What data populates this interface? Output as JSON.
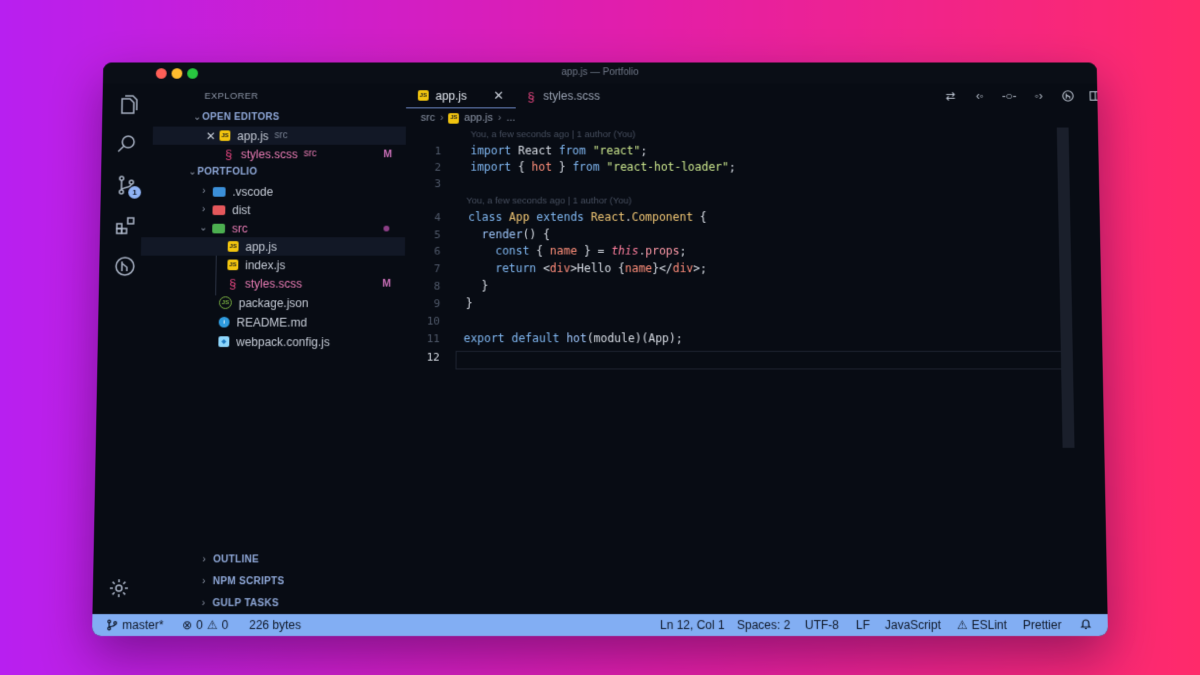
{
  "window": {
    "title": "app.js — Portfolio"
  },
  "sidebar": {
    "title": "EXPLORER",
    "open_editors": {
      "label": "OPEN EDITORS",
      "items": [
        {
          "name": "app.js",
          "hint": "src"
        },
        {
          "name": "styles.scss",
          "hint": "src",
          "status": "M"
        }
      ]
    },
    "project": {
      "label": "PORTFOLIO",
      "items": [
        {
          "name": ".vscode"
        },
        {
          "name": "dist"
        },
        {
          "name": "src"
        },
        {
          "name": "app.js"
        },
        {
          "name": "index.js"
        },
        {
          "name": "styles.scss",
          "status": "M"
        },
        {
          "name": "package.json"
        },
        {
          "name": "README.md"
        },
        {
          "name": "webpack.config.js"
        }
      ]
    },
    "bottom_sections": [
      "OUTLINE",
      "NPM SCRIPTS",
      "GULP TASKS"
    ],
    "scm_badge": "1"
  },
  "tabs": [
    {
      "label": "app.js",
      "active": true
    },
    {
      "label": "styles.scss",
      "active": false
    }
  ],
  "breadcrumb": [
    "src",
    "app.js",
    "..."
  ],
  "editor": {
    "blame_line": "You, a few seconds ago | 1 author (You)",
    "line_numbers": [
      "1",
      "2",
      "3",
      "4",
      "5",
      "6",
      "7",
      "8",
      "9",
      "10",
      "11",
      "12"
    ],
    "current_line": 12
  },
  "statusbar": {
    "branch": "master*",
    "errors": "0",
    "warnings": "0",
    "file_size": "226 bytes",
    "position": "Ln 12, Col 1",
    "spaces": "Spaces: 2",
    "encoding": "UTF-8",
    "eol": "LF",
    "language": "JavaScript",
    "eslint": "ESLint",
    "prettier": "Prettier"
  },
  "colors": {
    "statusbar": "#82aef3",
    "background": "#080c14",
    "accent": "#6e89c8"
  }
}
